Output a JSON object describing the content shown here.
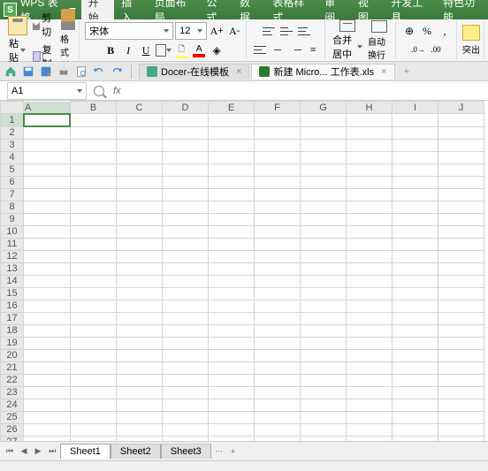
{
  "app": {
    "logo": "S",
    "name": "WPS 表格"
  },
  "menu": [
    "开始",
    "插入",
    "页面布局",
    "公式",
    "数据",
    "表格样式",
    "审阅",
    "视图",
    "开发工具",
    "特色功能"
  ],
  "menu_active": 0,
  "ribbon": {
    "paste": "粘贴",
    "cut": "剪切",
    "copy": "复制",
    "format_painter": "格式刷",
    "font_name": "宋体",
    "font_size": "12",
    "merge": "合并居中",
    "wrap": "自动换行",
    "percent": "%",
    "highlight": "突出"
  },
  "doc_tabs": [
    {
      "label": "Docer-在线模板"
    },
    {
      "label": "新建 Micro... 工作表.xls"
    }
  ],
  "doc_active": 1,
  "namebox": "A1",
  "columns": [
    "A",
    "B",
    "C",
    "D",
    "E",
    "F",
    "G",
    "H",
    "I",
    "J"
  ],
  "rows": [
    1,
    2,
    3,
    4,
    5,
    6,
    7,
    8,
    9,
    10,
    11,
    12,
    13,
    14,
    15,
    16,
    17,
    18,
    19,
    20,
    21,
    22,
    23,
    24,
    25,
    26,
    27
  ],
  "selected": {
    "row": 1,
    "col": "A"
  },
  "sheets": [
    "Sheet1",
    "Sheet2",
    "Sheet3"
  ],
  "sheet_active": 0,
  "nav": {
    "first": "⏮",
    "prev": "◀",
    "next": "▶",
    "last": "⏭"
  },
  "dots": "⋯",
  "add_sheet": "+"
}
